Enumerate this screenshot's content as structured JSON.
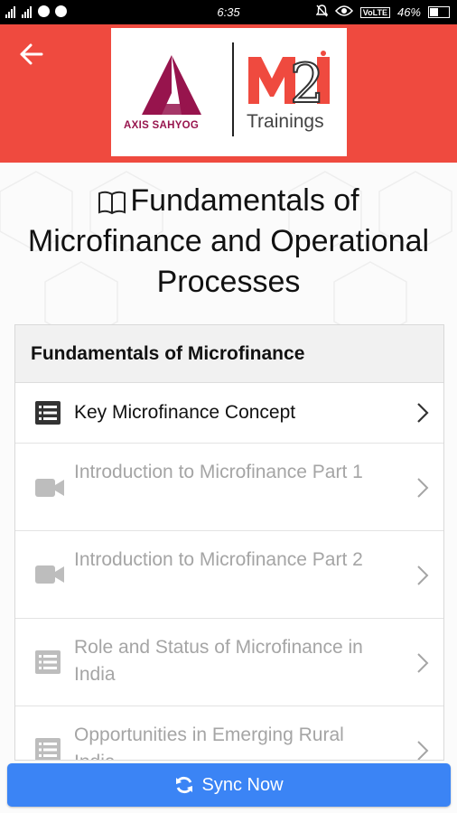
{
  "status_bar": {
    "time": "6:35",
    "network": "VoLTE",
    "battery": "46%"
  },
  "header": {
    "back_icon": "arrow-left-icon",
    "logo_left_text": "AXIS SAHYOG",
    "logo_right_mark": "M2i",
    "logo_right_text": "Trainings",
    "colors": {
      "header_bg": "#ef4a3f",
      "axis_brand": "#97144d",
      "m2i_brand": "#ef4a3f"
    }
  },
  "page": {
    "title": "Fundamentals of Microfinance and Operational Processes",
    "title_icon": "book-icon"
  },
  "module": {
    "title": "Fundamentals of Microfinance",
    "lessons": [
      {
        "label": "Key Microfinance Concept",
        "icon": "list-icon",
        "enabled": true
      },
      {
        "label": "Introduction to Microfinance Part 1",
        "icon": "video-icon",
        "enabled": false
      },
      {
        "label": "Introduction to Microfinance Part 2",
        "icon": "video-icon",
        "enabled": false
      },
      {
        "label": "Role and Status of Microfinance in India",
        "icon": "list-icon",
        "enabled": false
      },
      {
        "label": "Opportunities in Emerging Rural India",
        "icon": "list-icon",
        "enabled": false
      }
    ]
  },
  "footer": {
    "sync_label": "Sync Now",
    "sync_icon": "sync-icon",
    "color": "#3b84f5"
  }
}
